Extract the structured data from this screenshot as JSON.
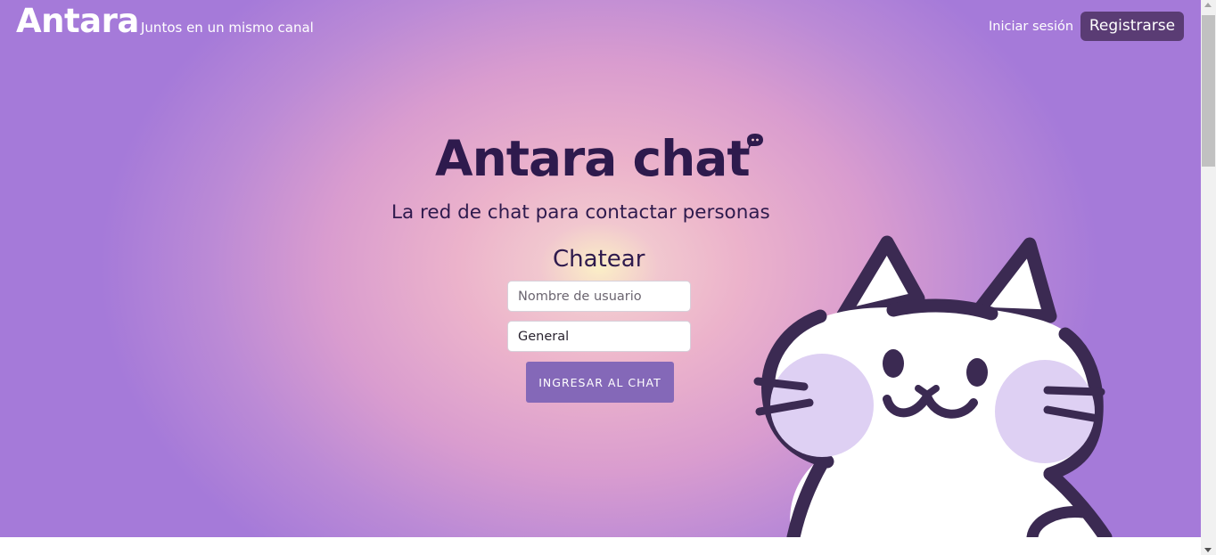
{
  "header": {
    "brand": "Antara",
    "tagline": "Juntos en un mismo canal",
    "login_label": "Iniciar sesión",
    "register_label": "Registrarse"
  },
  "hero": {
    "title": "Antara chat",
    "title_icon": "chat-bubble-icon",
    "subtitle": "La red de chat para contactar personas",
    "illustration": "cat-illustration"
  },
  "chat_form": {
    "title": "Chatear",
    "username_placeholder": "Nombre de usuario",
    "room_value": "General",
    "submit_label": "INGRESAR AL CHAT"
  },
  "colors": {
    "title_text": "#2e1a4d",
    "register_button": "#5a3c74",
    "submit_button": "#8468b8",
    "gradient_center": "#fbefc6",
    "gradient_edge": "#a57ad9"
  }
}
